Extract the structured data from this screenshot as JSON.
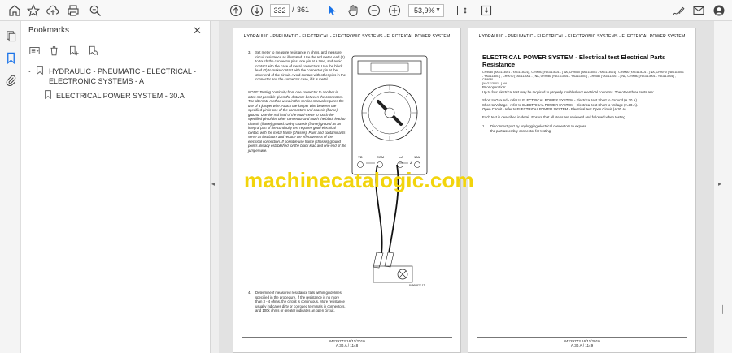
{
  "toolbar": {
    "current_page": "332",
    "page_separator": "/",
    "total_pages": "361",
    "zoom": "53,9%"
  },
  "bookmarks": {
    "title": "Bookmarks",
    "items": [
      {
        "label_line1": "HYDRAULIC - PNEUMATIC - ELECTRICAL -",
        "label_line2": "ELECTRONIC SYSTEMS - A"
      },
      {
        "label_line1": "ELECTRICAL POWER SYSTEM - 30.A",
        "label_line2": ""
      }
    ]
  },
  "left_page": {
    "header": "HYDRAULIC - PNEUMATIC - ELECTRICAL - ELECTRONIC SYSTEMS - ELECTRICAL POWER SYSTEM",
    "step3_num": "3.",
    "step3_text": "Set meter to measure resistance in ohms, and measure circuit resistance as illustrated. Use the red meter lead (1) to touch the connector pins, one pin at a time, and avoid contact with the case of metal connectors. Use the black lead (2) to make contact with the connector pin at the other end of the circuit. Avoid contact with other pins in the connector and the connector case, if it is metal.",
    "note_text": "NOTE: Testing continuity from one connector to another is often not possible given the distance between the connectors. The alternate method used in this service manual requires the use of a jumper wire. Attach the jumper wire between the specified pin in one of the connectors and chassis (frame) ground. Use the red lead of the multi-meter to touch the specified pin of the other connector and touch the black lead to chassis (frame) ground. Using chassis (frame) ground as an integral part of the continuity test requires good electrical contact with the metal frame (chassis). Paint and contaminants serve as insulators and reduce the effectiveness of the electrical connection. If possible use frame (chassis) ground points already established for the black lead and one end of the jumper wire.",
    "callout1": "1",
    "callout2": "2",
    "figure_id": "84569877   17",
    "meter_labels": {
      "vohm": "VΩ",
      "com": "COM",
      "ma": "mA",
      "ten_a": "10A"
    },
    "step4_num": "4.",
    "step4_text": "Determine if measured resistance falls within guidelines specified in the procedure. If the resistance is no more than 3 - 4 ohms, the circuit is continuous. More resistance usually indicates dirty or corroded terminals in connectors, and 100k ohms or greater indicates an open circuit.",
    "footer_line1": "84229773 16/11/2010",
    "footer_line2": "A.30.A / 1148"
  },
  "right_page": {
    "header": "HYDRAULIC - PNEUMATIC - ELECTRICAL - ELECTRONIC SYSTEMS - ELECTRICAL POWER SYSTEM",
    "title_line1": "ELECTRICAL POWER SYSTEM - Electrical test Electrical Parts",
    "title_line2": "Resistance",
    "models_line1": "CR9040 [YAG113001 - YAG113001] , CR9040 [YAG113001 - ] NA, CR9060 [YAG113001 - YAG113001] , CR9060 [YAG113001 - ] NA, CR9070 [YAG113001",
    "models_line2": "- YAG113001] , CR9070 [YAG113001 - ] NA, CR9080 [YAG113001 - YAG113001] , CR9080 [YAG113001 - ] NA, CR9080 [YAG113001 - YAG113001] , CR9080",
    "models_line3": "[YAG113001 - ] NA",
    "prior_label": "Prior operation:",
    "prior_text": "Up to four electrical test may be required to properly troubleshoot electrical concerns. The other three tests are:",
    "short_ground": "Short to Ground - refer to ELECTRICAL POWER SYSTEM - Electrical test Short to Ground (A.30.A).",
    "short_voltage": "Short to Voltage - refer to ELECTRICAL POWER SYSTEM - Electrical test Short to Voltage (A.30.A).",
    "open_circuit": "Open Circuit - refer to ELECTRICAL POWER SYSTEM - Electrical test Open Circuit (A.30.A).",
    "each_test": "Each test is described in detail. Ensure that all steps are reviewed and followed when testing.",
    "step1_num": "1.",
    "step1_text": "Disconnect part by unplugging electrical connectors to expose the part assembly connector for testing.",
    "footer_line1": "84229773 16/11/2010",
    "footer_line2": "A.30.A / 1149"
  },
  "watermark": "machinecatalogic.com",
  "colors": {
    "watermark": "#f2d40c",
    "accent": "#1a73e8",
    "toolbar_bg": "#f8f8f8"
  }
}
